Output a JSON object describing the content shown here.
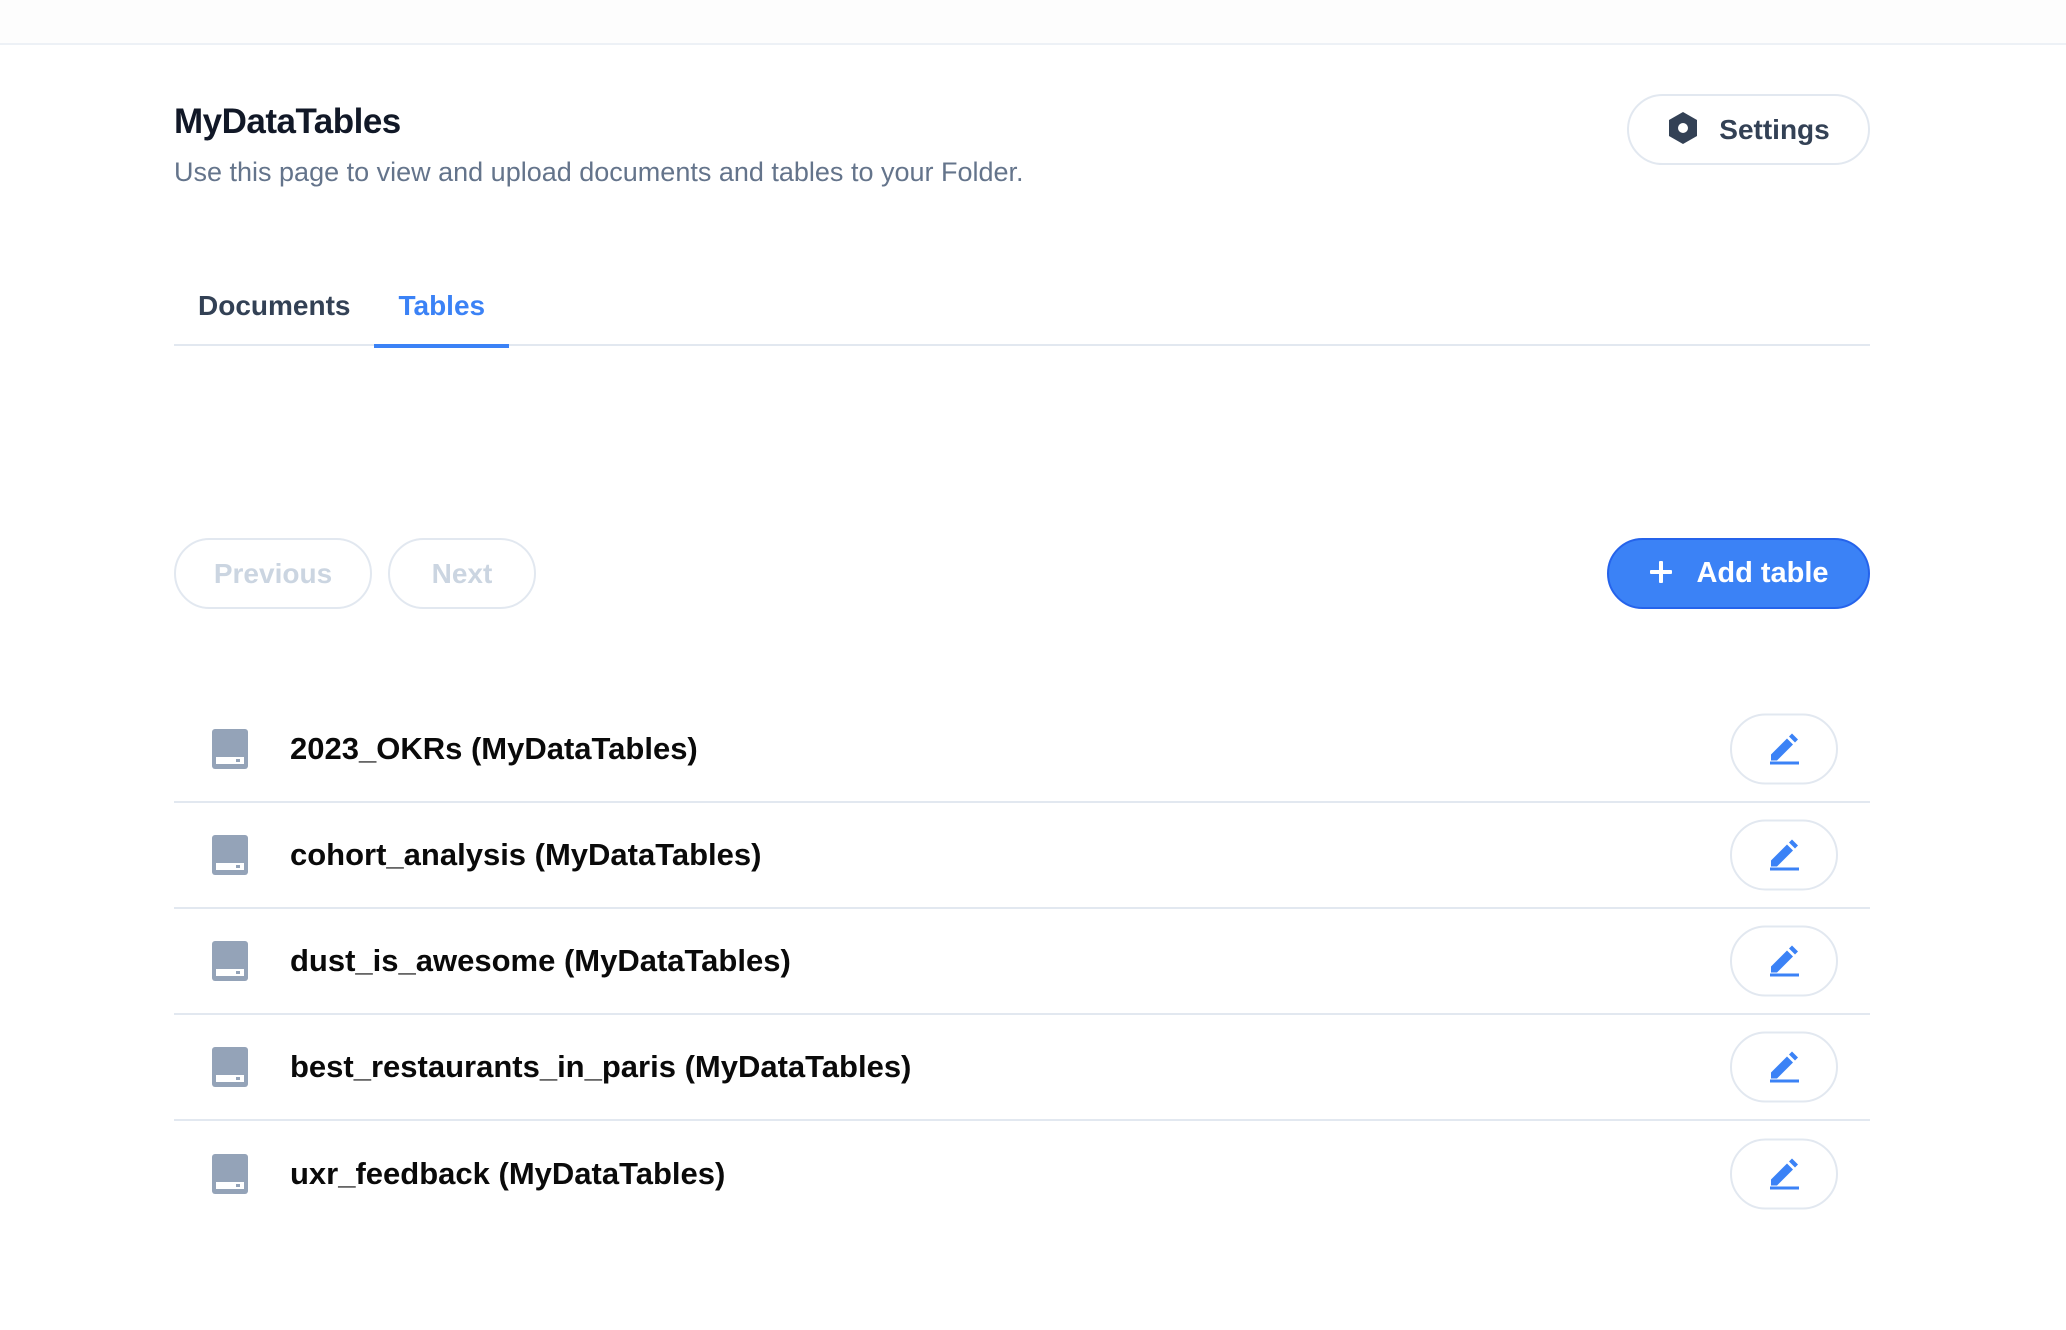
{
  "header": {
    "title": "MyDataTables",
    "subtitle": "Use this page to view and upload documents and tables to your Folder.",
    "settings_label": "Settings",
    "settings_icon": "hexagon-nut-icon"
  },
  "tabs": [
    {
      "label": "Documents",
      "active": false
    },
    {
      "label": "Tables",
      "active": true
    }
  ],
  "pagination": {
    "previous_label": "Previous",
    "next_label": "Next",
    "previous_enabled": false,
    "next_enabled": false
  },
  "add_button": {
    "label": "Add table",
    "icon": "plus-icon"
  },
  "tables": [
    {
      "name": "2023_OKRs (MyDataTables)",
      "icon": "table-drive-icon",
      "action_icon": "pencil-icon"
    },
    {
      "name": "cohort_analysis (MyDataTables)",
      "icon": "table-drive-icon",
      "action_icon": "pencil-icon"
    },
    {
      "name": "dust_is_awesome (MyDataTables)",
      "icon": "table-drive-icon",
      "action_icon": "pencil-icon"
    },
    {
      "name": "best_restaurants_in_paris (MyDataTables)",
      "icon": "table-drive-icon",
      "action_icon": "pencil-icon"
    },
    {
      "name": "uxr_feedback (MyDataTables)",
      "icon": "table-drive-icon",
      "action_icon": "pencil-icon"
    }
  ],
  "colors": {
    "accent": "#3b82f6",
    "text_primary": "#111827",
    "text_secondary": "#64748b",
    "border": "#e2e8f0",
    "icon_gray": "#94a3b8",
    "disabled_text": "#cbd5e1"
  }
}
